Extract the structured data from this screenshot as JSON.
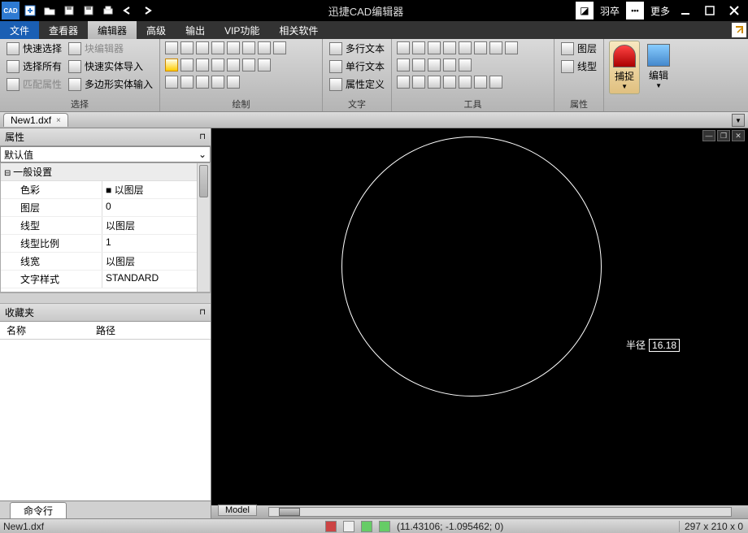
{
  "app": {
    "title": "迅捷CAD编辑器",
    "user": "羽卒",
    "more": "更多"
  },
  "menu": {
    "file": "文件",
    "viewer": "查看器",
    "editor": "编辑器",
    "advanced": "高级",
    "output": "输出",
    "vip": "VIP功能",
    "related": "相关软件"
  },
  "ribbon": {
    "select": {
      "label": "选择",
      "quick": "快速选择",
      "all": "选择所有",
      "match": "匹配属性",
      "blockEdit": "块编辑器",
      "entityImport": "快速实体导入",
      "polyImport": "多边形实体输入"
    },
    "draw": {
      "label": "绘制"
    },
    "text": {
      "label": "文字",
      "multiline": "多行文本",
      "singleline": "单行文本",
      "attrdef": "属性定义"
    },
    "tools": {
      "label": "工具"
    },
    "props": {
      "label": "属性",
      "layer": "图层",
      "linetype": "线型"
    },
    "snap": {
      "label": "捕捉"
    },
    "edit": {
      "label": "编辑"
    }
  },
  "doc": {
    "tabName": "New1.dxf"
  },
  "panels": {
    "properties": {
      "title": "属性",
      "default": "默认值",
      "category": "一般设置",
      "rows": [
        {
          "k": "色彩",
          "v": "■ 以图层"
        },
        {
          "k": "图层",
          "v": "0"
        },
        {
          "k": "线型",
          "v": "以图层"
        },
        {
          "k": "线型比例",
          "v": "1"
        },
        {
          "k": "线宽",
          "v": "以图层"
        },
        {
          "k": "文字样式",
          "v": "STANDARD"
        }
      ]
    },
    "favorites": {
      "title": "收藏夹",
      "colName": "名称",
      "colPath": "路径"
    },
    "cmdline": "命令行"
  },
  "canvas": {
    "radiusLabel": "半径",
    "radiusValue": "16.18",
    "modelTab": "Model"
  },
  "status": {
    "file": "New1.dxf",
    "coords": "(11.43106; -1.095462; 0)",
    "dims": "297 x 210 x 0"
  }
}
